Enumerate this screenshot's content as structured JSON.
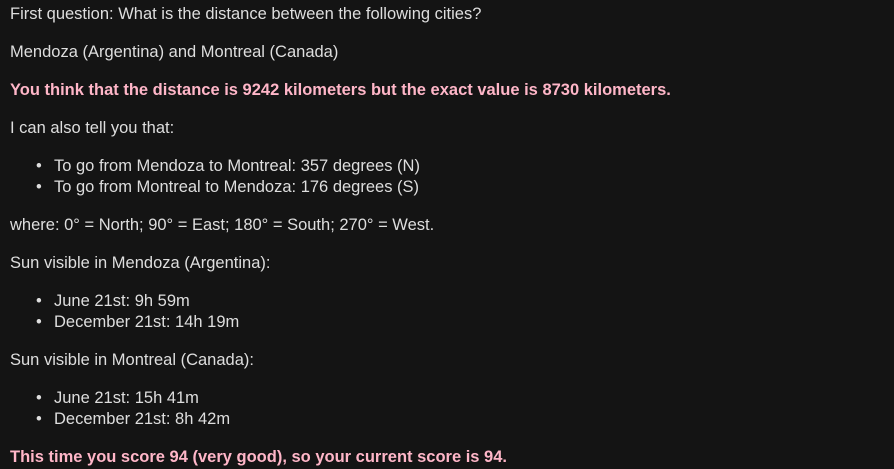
{
  "question": "First question: What is the distance between the following cities?",
  "cities": "Mendoza (Argentina) and Montreal (Canada)",
  "result": "You think that the distance is 9242 kilometers but the exact value is 8730 kilometers.",
  "intro": "I can also tell you that:",
  "directions": [
    "To go from Mendoza to Montreal: 357 degrees (N)",
    "To go from Montreal to Mendoza: 176 degrees (S)"
  ],
  "legend": "where: 0° = North; 90° = East; 180° = South; 270° = West.",
  "sun_city1": {
    "title": "Sun visible in Mendoza (Argentina):",
    "items": [
      "June 21st: 9h 59m",
      "December 21st: 14h 19m"
    ]
  },
  "sun_city2": {
    "title": "Sun visible in Montreal (Canada):",
    "items": [
      "June 21st: 15h 41m",
      "December 21st: 8h 42m"
    ]
  },
  "score": "This time you score 94 (very good), so your current score is 94.",
  "bullet_char": "•"
}
